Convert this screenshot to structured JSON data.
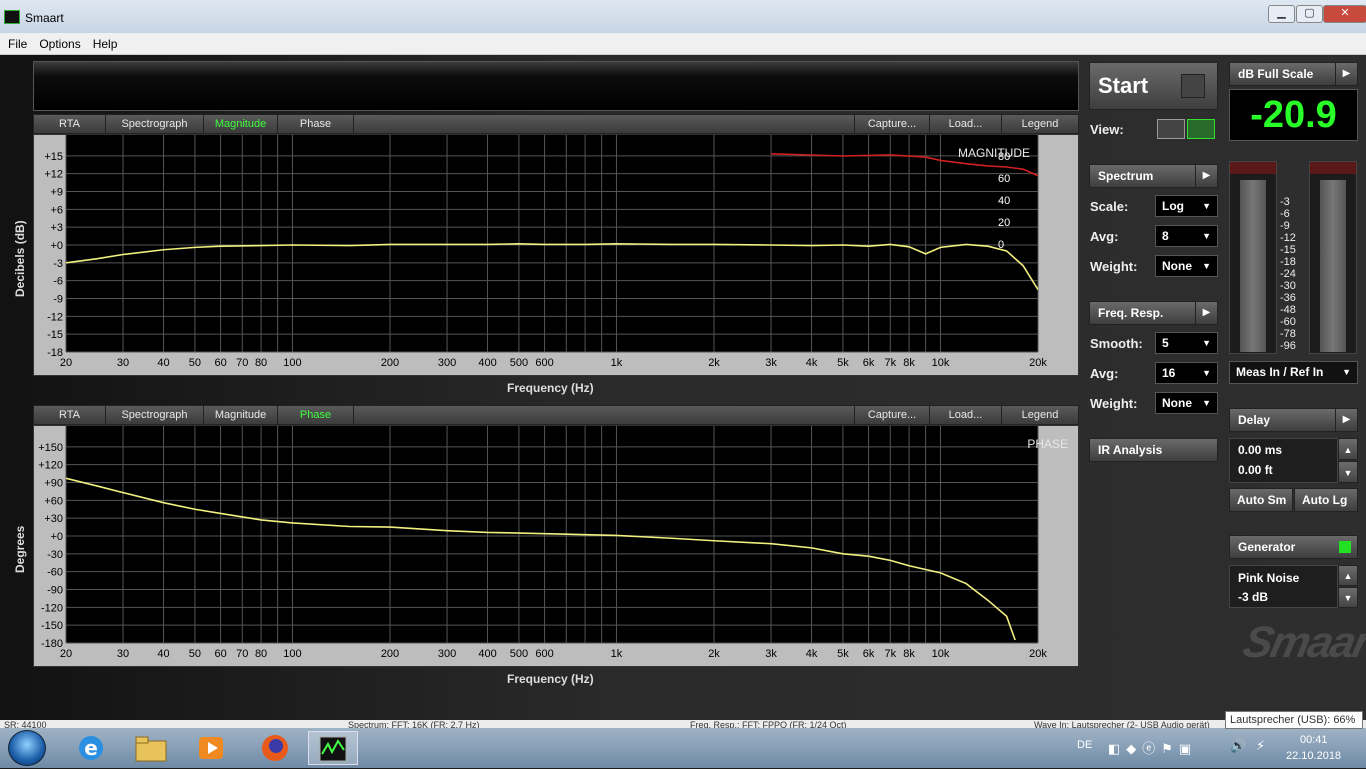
{
  "window": {
    "title": "Smaart",
    "min": "▁",
    "max": "▢",
    "close": "✕"
  },
  "menu": [
    "File",
    "Options",
    "Help"
  ],
  "tabs": {
    "rta": "RTA",
    "spectrograph": "Spectrograph",
    "magnitude": "Magnitude",
    "phase": "Phase",
    "capture": "Capture...",
    "load": "Load...",
    "legend": "Legend"
  },
  "magnitude_plot": {
    "trace_label": "MAGNITUDE",
    "ylabel": "Decibels (dB)",
    "xlabel": "Frequency (Hz)"
  },
  "phase_plot": {
    "trace_label": "PHASE",
    "ylabel": "Degrees",
    "xlabel": "Frequency (Hz)"
  },
  "chart_data": [
    {
      "type": "line",
      "title": "MAGNITUDE",
      "xlabel": "Frequency (Hz)",
      "ylabel": "Decibels (dB)",
      "xscale": "log",
      "xlim": [
        20,
        20000
      ],
      "ylim": [
        -18,
        18
      ],
      "x_ticks": [
        "20",
        "30",
        "40",
        "50",
        "60",
        "70",
        "80",
        "100",
        "200",
        "300",
        "400",
        "500",
        "600",
        "1k",
        "2k",
        "3k",
        "4k",
        "5k",
        "6k",
        "7k",
        "8k",
        "10k",
        "20k"
      ],
      "y_ticks": [
        "+15",
        "+12",
        "+9",
        "+6",
        "+3",
        "+0",
        "-3",
        "-6",
        "-9",
        "-12",
        "-15",
        "-18"
      ],
      "secondary_y_ticks": [
        "80",
        "60",
        "40",
        "20",
        "0"
      ],
      "grid": true,
      "series": [
        {
          "color": "#f2f080",
          "x": [
            20,
            25,
            30,
            40,
            50,
            60,
            80,
            100,
            150,
            200,
            300,
            400,
            500,
            600,
            800,
            1000,
            1500,
            2000,
            3000,
            4000,
            5000,
            6000,
            7000,
            8000,
            9000,
            10000,
            12000,
            14000,
            16000,
            18000,
            20000
          ],
          "y": [
            -3.0,
            -2.3,
            -1.6,
            -0.8,
            -0.4,
            -0.2,
            -0.1,
            0.0,
            -0.1,
            0.1,
            0.1,
            0.1,
            0.2,
            0.1,
            0.1,
            0.2,
            0.1,
            0.1,
            0.0,
            -0.1,
            0.0,
            -0.2,
            0.1,
            -0.3,
            -1.5,
            -0.4,
            0.1,
            -0.2,
            -1.0,
            -3.5,
            -7.5
          ]
        },
        {
          "color": "#d02020",
          "x": [
            3000,
            5000,
            7000,
            9000,
            10000,
            12000,
            14000,
            16000,
            18000,
            20000
          ],
          "y": [
            82,
            80,
            81,
            79,
            76,
            73,
            71,
            70,
            68,
            62
          ]
        }
      ]
    },
    {
      "type": "line",
      "title": "PHASE",
      "xlabel": "Frequency (Hz)",
      "ylabel": "Degrees",
      "xscale": "log",
      "xlim": [
        20,
        20000
      ],
      "ylim": [
        -180,
        180
      ],
      "x_ticks": [
        "20",
        "30",
        "40",
        "50",
        "60",
        "70",
        "80",
        "100",
        "200",
        "300",
        "400",
        "500",
        "600",
        "1k",
        "2k",
        "3k",
        "4k",
        "5k",
        "6k",
        "7k",
        "8k",
        "10k",
        "20k"
      ],
      "y_ticks": [
        "+150",
        "+120",
        "+90",
        "+60",
        "+30",
        "+0",
        "-30",
        "-60",
        "-90",
        "-120",
        "-150",
        "-180"
      ],
      "grid": true,
      "series": [
        {
          "color": "#f2f080",
          "x": [
            20,
            25,
            30,
            40,
            50,
            60,
            80,
            100,
            150,
            200,
            300,
            400,
            500,
            700,
            1000,
            1500,
            2000,
            3000,
            4000,
            5000,
            6000,
            7000,
            8000,
            10000,
            12000,
            14000,
            16000,
            17000
          ],
          "y": [
            97,
            84,
            73,
            56,
            45,
            38,
            27,
            22,
            16,
            15,
            9,
            6,
            5,
            3,
            1,
            -4,
            -8,
            -13,
            -20,
            -30,
            -34,
            -41,
            -50,
            -62,
            -80,
            -108,
            -135,
            -175
          ]
        }
      ]
    }
  ],
  "panel": {
    "start": "Start",
    "view": "View:",
    "spectrum": "Spectrum",
    "scale_label": "Scale:",
    "scale_value": "Log",
    "avg_label": "Avg:",
    "avg_value": "8",
    "weight_label": "Weight:",
    "weight_value": "None",
    "freqresp": "Freq. Resp.",
    "smooth_label": "Smooth:",
    "smooth_value": "5",
    "avg2_value": "16",
    "weight2_value": "None",
    "ir": "IR Analysis",
    "dbfs_label": "dB Full Scale",
    "dbfs_value": "-20.9",
    "meter_scale": [
      "-3",
      "-6",
      "-9",
      "-12",
      "-15",
      "-18",
      "-24",
      "-30",
      "-36",
      "-48",
      "-60",
      "-78",
      "-96"
    ],
    "meas_ref": "Meas In / Ref In",
    "delay": "Delay",
    "delay_ms": "0.00 ms",
    "delay_ft": "0.00 ft",
    "auto_sm": "Auto Sm",
    "auto_lg": "Auto Lg",
    "generator": "Generator",
    "gen_signal": "Pink Noise",
    "gen_level": "-3 dB",
    "logo": "Smaart",
    "generator_on_color": "#22e022"
  },
  "status": [
    "SR: 44100",
    "Spectrum: FFT: 16K (FR: 2.7 Hz)",
    "Freq. Resp.: FFT: FPPO (FR: 1/24 Oct)",
    "Wave In: Lautsprecher (2- USB Audio gerät)"
  ],
  "tray": {
    "lang": "DE",
    "time": "00:41",
    "date": "22.10.2018",
    "tooltip": "Lautsprecher (USB): 66%"
  }
}
